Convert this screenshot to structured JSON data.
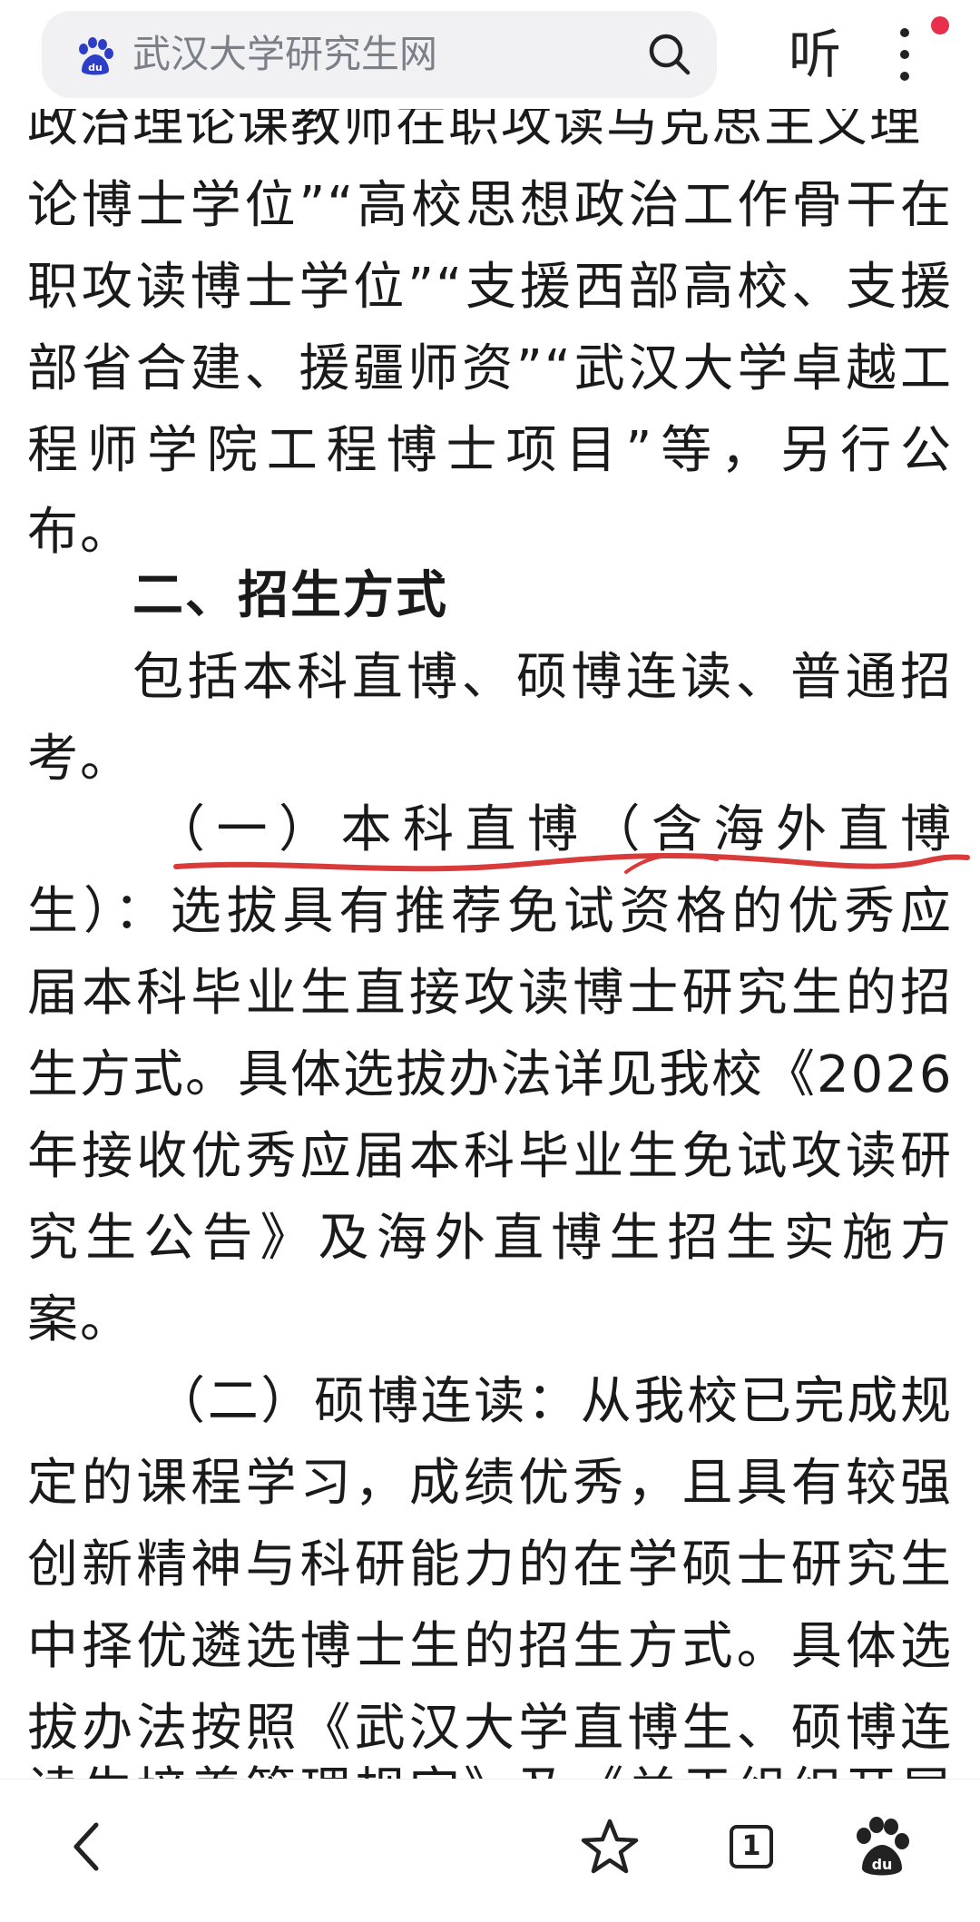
{
  "search_bar": {
    "query": "武汉大学研究生网",
    "logo_icon": "baidu-paw-icon",
    "search_icon": "magnifier-icon"
  },
  "listen_label": "听",
  "more_icon": "vertical-dots-icon",
  "colors": {
    "accent_red": "#e8304d",
    "underline_red": "#d93a3a",
    "baidu_blue": "#2c3ec6"
  },
  "article": {
    "lines": [
      "政治理论课教师在职攻读马克思主义理",
      "论博士学位”“高校思想政治工作骨干在",
      "职攻读博士学位”“支援西部高校、支援",
      "部省合建、援疆师资”“武汉大学卓越工",
      "程师学院工程博士项目”等，另行公",
      "布。",
      "二、招生方式",
      "包括本科直博、硕博连读、普通招",
      "考。",
      "（一）本科直博（含海外直博",
      "生）：选拔具有推荐免试资格的优秀应",
      "届本科毕业生直接攻读博士研究生的招",
      "生方式。具体选拔办法详见我校《2026",
      "年接收优秀应届本科毕业生免试攻读研",
      "究生公告》及海外直博生招生实施方",
      "案。",
      "（二）硕博连读：从我校已完成规",
      "定的课程学习，成绩优秀，且具有较强",
      "创新精神与科研能力的在学硕士研究生",
      "中择优遴选博士生的招生方式。具体选",
      "拔办法按照《武汉大学直博生、硕博连",
      "读生培养管理规定》及《关于组织开展"
    ]
  },
  "bottom_bar": {
    "back_icon": "chevron-left-icon",
    "favorite_icon": "star-icon",
    "tab_count": "1",
    "home_icon": "baidu-paw-icon"
  }
}
